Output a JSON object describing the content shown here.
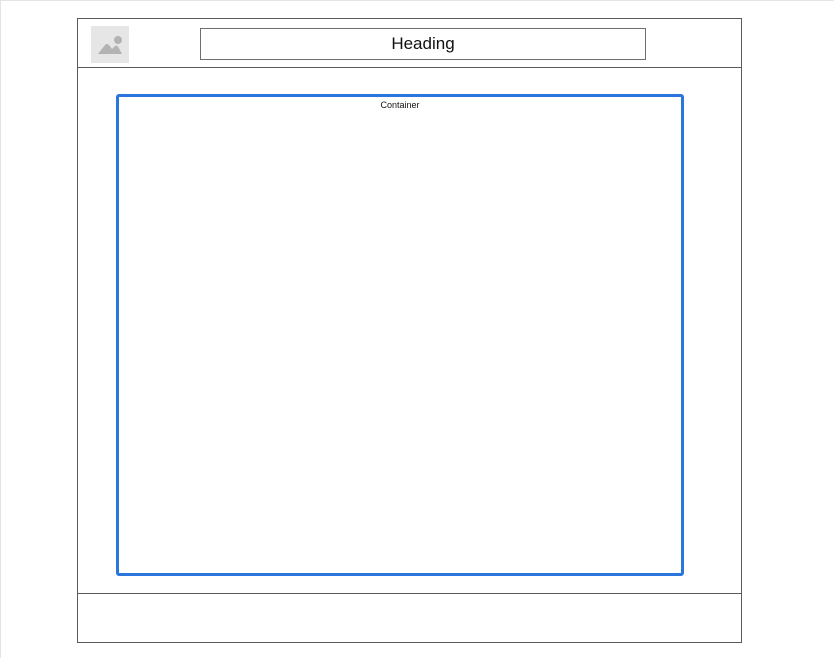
{
  "header": {
    "image_icon": "image-placeholder-icon",
    "heading": "Heading"
  },
  "main": {
    "container_label": "Container"
  },
  "colors": {
    "container_border": "#2a76dd",
    "frame_border": "#5a5a5a",
    "placeholder_bg": "#e6e6e6",
    "placeholder_glyph": "#b3b3b3"
  }
}
